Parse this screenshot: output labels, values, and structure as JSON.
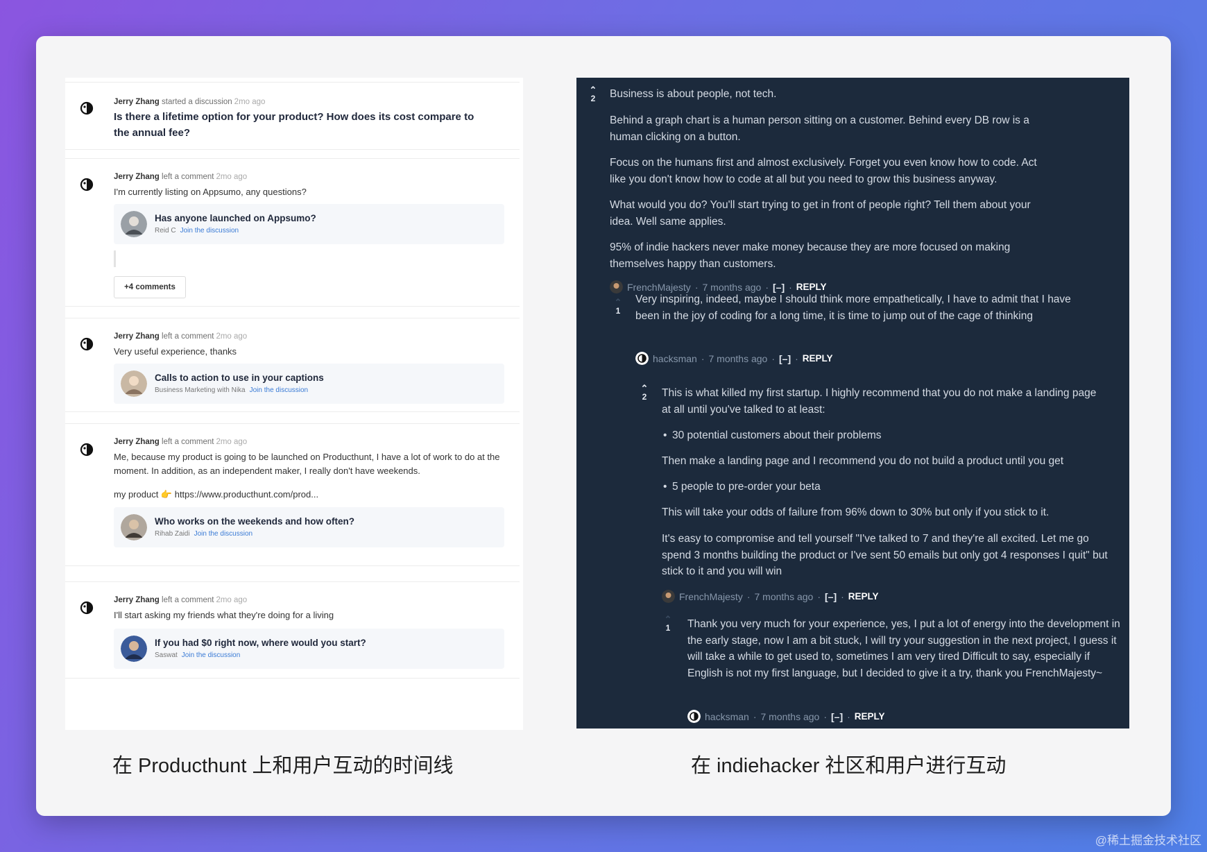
{
  "producthunt": {
    "cards": [
      {
        "author": "Jerry Zhang",
        "action": "started a discussion",
        "time": "2mo ago",
        "title": "Is there a lifetime option for your product? How does its cost compare to the annual fee?"
      },
      {
        "author": "Jerry Zhang",
        "action": "left a comment",
        "time": "2mo ago",
        "text": "I'm currently listing on Appsumo, any questions?",
        "quote": {
          "title": "Has anyone launched on Appsumo?",
          "by": "Reid C",
          "link": "Join the discussion"
        },
        "more": "+4 comments"
      },
      {
        "author": "Jerry Zhang",
        "action": "left a comment",
        "time": "2mo ago",
        "text": "Very useful experience, thanks",
        "quote": {
          "title": "Calls to action to use in your captions",
          "by": "Business Marketing with Nika",
          "link": "Join the discussion"
        }
      },
      {
        "author": "Jerry Zhang",
        "action": "left a comment",
        "time": "2mo ago",
        "text": "Me, because my product is going to be launched on Producthunt, I have a lot of work to do at the moment. In addition, as an independent maker, I really don't have weekends.",
        "text2": "my product 👉 https://www.producthunt.com/prod...",
        "quote": {
          "title": "Who works on the weekends and how often?",
          "by": "Rihab Zaidi",
          "link": "Join the discussion"
        }
      },
      {
        "author": "Jerry Zhang",
        "action": "left a comment",
        "time": "2mo ago",
        "text": "I'll start asking my friends what they're doing for a living",
        "quote": {
          "title": "If you had $0 right now, where would you start?",
          "by": "Saswat",
          "link": "Join the discussion"
        }
      }
    ]
  },
  "indiehackers": {
    "c1": {
      "votes": "2",
      "paragraphs": [
        "Business is about people, not tech.",
        "Behind a graph chart is a human person sitting on a customer. Behind every DB row is a human clicking on a button.",
        "Focus on the humans first and almost exclusively. Forget you even know how to code. Act like you don't know how to code at all but you need to grow this business anyway.",
        "What would you do? You'll start trying to get in front of people right? Tell them about your idea. Well same applies.",
        "95% of indie hackers never make money because they are more focused on making themselves happy than customers."
      ],
      "user": "FrenchMajesty",
      "time": "7 months ago",
      "toggle": "[–]",
      "reply": "REPLY"
    },
    "c2": {
      "votes": "1",
      "paragraphs": [
        "Very inspiring, indeed, maybe I should think more empathetically, I have to admit that I have been in the joy of coding for a long time, it is time to jump out of the cage of thinking"
      ],
      "user": "hacksman",
      "time": "7 months ago",
      "toggle": "[–]",
      "reply": "REPLY"
    },
    "c3": {
      "votes": "2",
      "p1": "This is what killed my first startup. I highly recommend that you do not make a landing page at all until you've talked to at least:",
      "b1": "30 potential customers about their problems",
      "p2": "Then make a landing page and I recommend you do not build a product until you get",
      "b2": "5 people to pre-order your beta",
      "p3": "This will take your odds of failure from 96% down to 30% but only if you stick to it.",
      "p4": "It's easy to compromise and tell yourself \"I've talked to 7 and they're all excited. Let me go spend 3 months building the product or I've sent 50 emails but only got 4 responses I quit\" but stick to it and you will win",
      "user": "FrenchMajesty",
      "time": "7 months ago",
      "toggle": "[–]",
      "reply": "REPLY"
    },
    "c4": {
      "votes": "1",
      "paragraphs": [
        "Thank you very much for your experience, yes, I put a lot of energy into the development in the early stage, now I am a bit stuck, I will try your suggestion in the next project, I guess it will take a while to get used to, sometimes I am very tired Difficult to say, especially if English is not my first language, but I decided to give it a try, thank you FrenchMajesty~"
      ],
      "user": "hacksman",
      "time": "7 months ago",
      "toggle": "[–]",
      "reply": "REPLY"
    }
  },
  "captions": {
    "left": "在 Producthunt 上和用户互动的时间线",
    "right": "在 indiehacker 社区和用户进行互动"
  },
  "watermark": "@稀土掘金技术社区"
}
